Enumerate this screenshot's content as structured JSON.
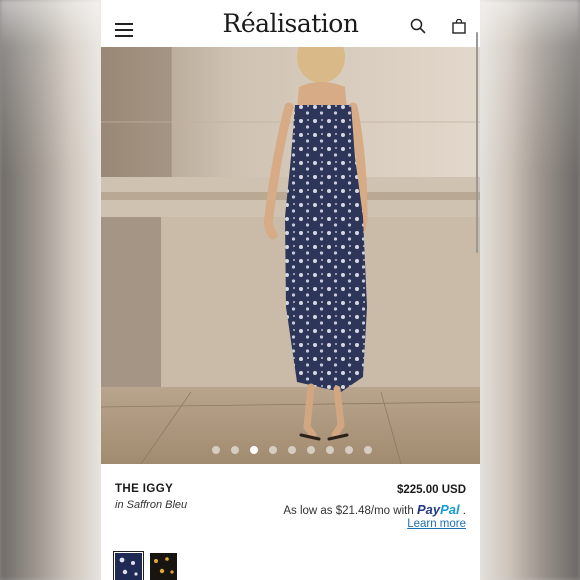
{
  "header": {
    "logo": "Réalisation",
    "menu_icon": "hamburger-menu-icon",
    "search_icon": "search-icon",
    "bag_icon": "shopping-bag-icon"
  },
  "gallery": {
    "slide_count": 9,
    "active_slide": 3
  },
  "product": {
    "name": "THE IGGY",
    "variant": "in Saffron Bleu",
    "price": "$225.00 USD",
    "installment_text": "As low as $21.48/mo with",
    "paypal_pay": "Pay",
    "paypal_pal": "Pal",
    "installment_suffix": ".",
    "learn_more": "Learn more"
  },
  "swatches": [
    {
      "color": "#1f2a55",
      "selected": true
    },
    {
      "color": "#181410",
      "selected": false
    }
  ]
}
